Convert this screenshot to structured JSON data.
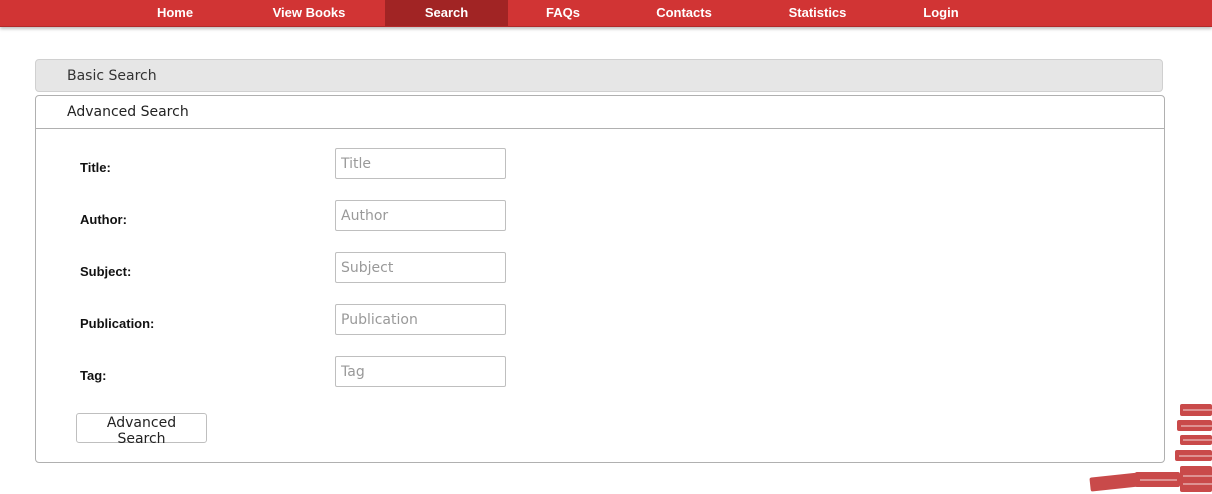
{
  "nav": {
    "items": [
      {
        "label": "Home"
      },
      {
        "label": "View Books"
      },
      {
        "label": "Search",
        "active": true
      },
      {
        "label": "FAQs"
      },
      {
        "label": "Contacts"
      },
      {
        "label": "Statistics"
      },
      {
        "label": "Login"
      }
    ]
  },
  "search": {
    "basic_label": "Basic Search",
    "advanced_label": "Advanced Search",
    "fields": [
      {
        "label": "Title:",
        "placeholder": "Title"
      },
      {
        "label": "Author:",
        "placeholder": "Author"
      },
      {
        "label": "Subject:",
        "placeholder": "Subject"
      },
      {
        "label": "Publication:",
        "placeholder": "Publication"
      },
      {
        "label": "Tag:",
        "placeholder": "Tag"
      }
    ],
    "submit_label": "Advanced Search"
  },
  "colors": {
    "nav_bg": "#d13434",
    "nav_active": "#a12424"
  },
  "icons": {
    "decoration": "books-stack-icon"
  }
}
